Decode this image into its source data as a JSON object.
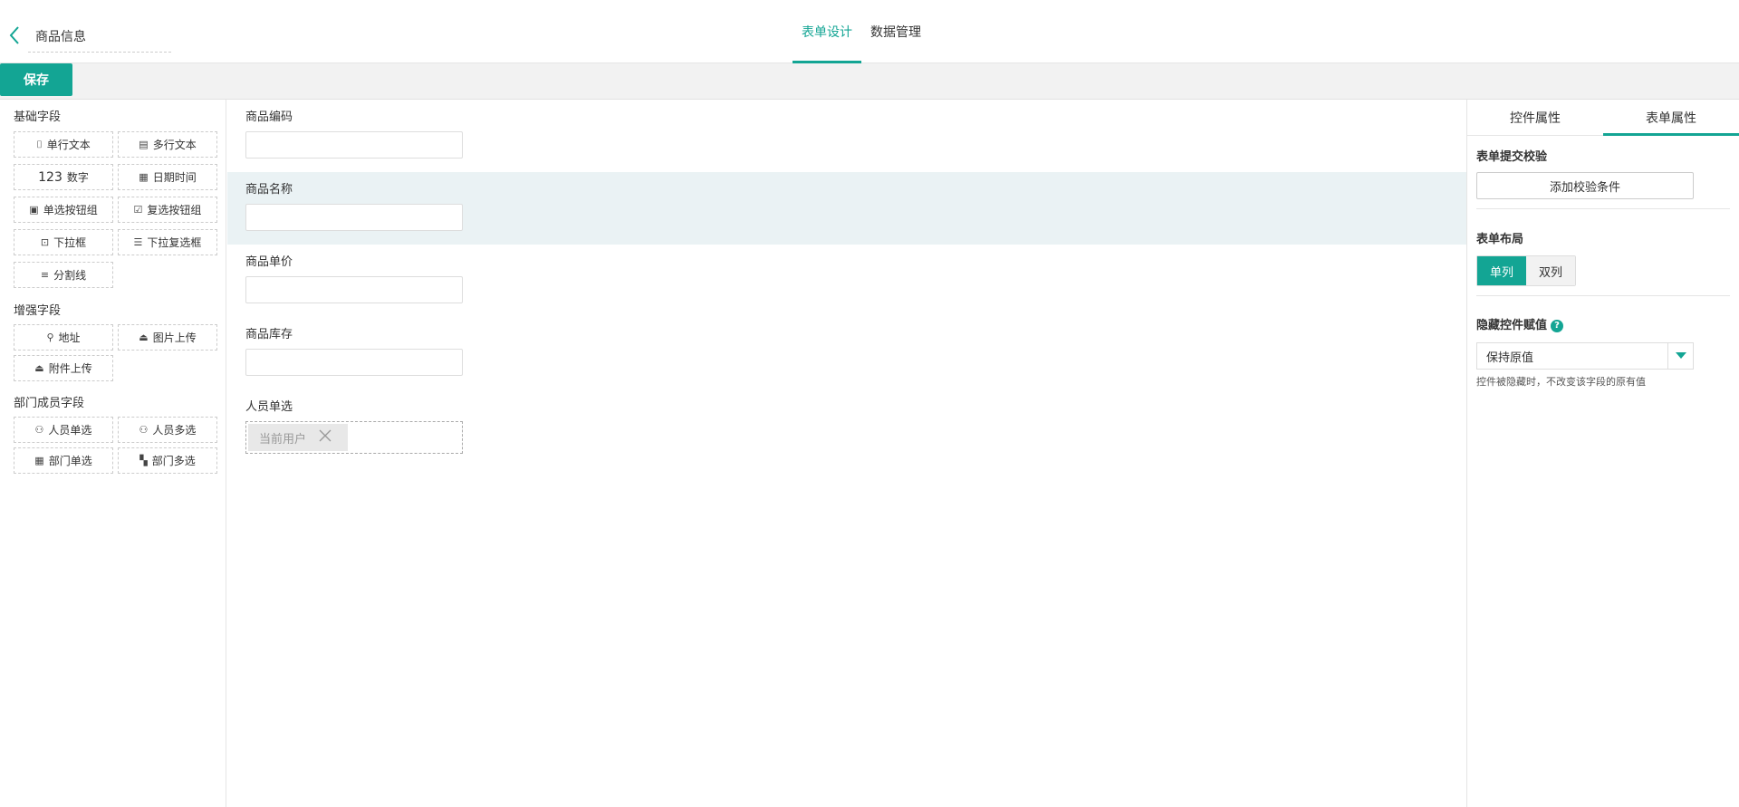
{
  "header": {
    "title": "商品信息",
    "tabs": [
      {
        "label": "表单设计",
        "active": true
      },
      {
        "label": "数据管理",
        "active": false
      }
    ]
  },
  "toolbar": {
    "save_label": "保存"
  },
  "left": {
    "groups": [
      {
        "title": "基础字段",
        "items": [
          "单行文本",
          "多行文本",
          "数字",
          "日期时间",
          "单选按钮组",
          "复选按钮组",
          "下拉框",
          "下拉复选框",
          "分割线"
        ]
      },
      {
        "title": "增强字段",
        "items": [
          "地址",
          "图片上传",
          "附件上传"
        ]
      },
      {
        "title": "部门成员字段",
        "items": [
          "人员单选",
          "人员多选",
          "部门单选",
          "部门多选"
        ]
      }
    ],
    "number_prefix": "123"
  },
  "canvas": {
    "fields": [
      {
        "label": "商品编码",
        "selected": false
      },
      {
        "label": "商品名称",
        "selected": true
      },
      {
        "label": "商品单价",
        "selected": false
      },
      {
        "label": "商品库存",
        "selected": false
      },
      {
        "label": "人员单选",
        "selected": false
      }
    ],
    "user_chip": "当前用户"
  },
  "right": {
    "tabs": [
      {
        "label": "控件属性",
        "active": false
      },
      {
        "label": "表单属性",
        "active": true
      }
    ],
    "submit_check_title": "表单提交校验",
    "add_condition_label": "添加校验条件",
    "layout_title": "表单布局",
    "layout_options": [
      {
        "label": "单列",
        "active": true
      },
      {
        "label": "双列",
        "active": false
      }
    ],
    "hidden_assign_title": "隐藏控件赋值",
    "hidden_assign_value": "保持原值",
    "hidden_assign_hint": "控件被隐藏时，不改变该字段的原有值"
  },
  "colors": {
    "accent": "#13a594",
    "selected_row": "#eaf2f4"
  }
}
